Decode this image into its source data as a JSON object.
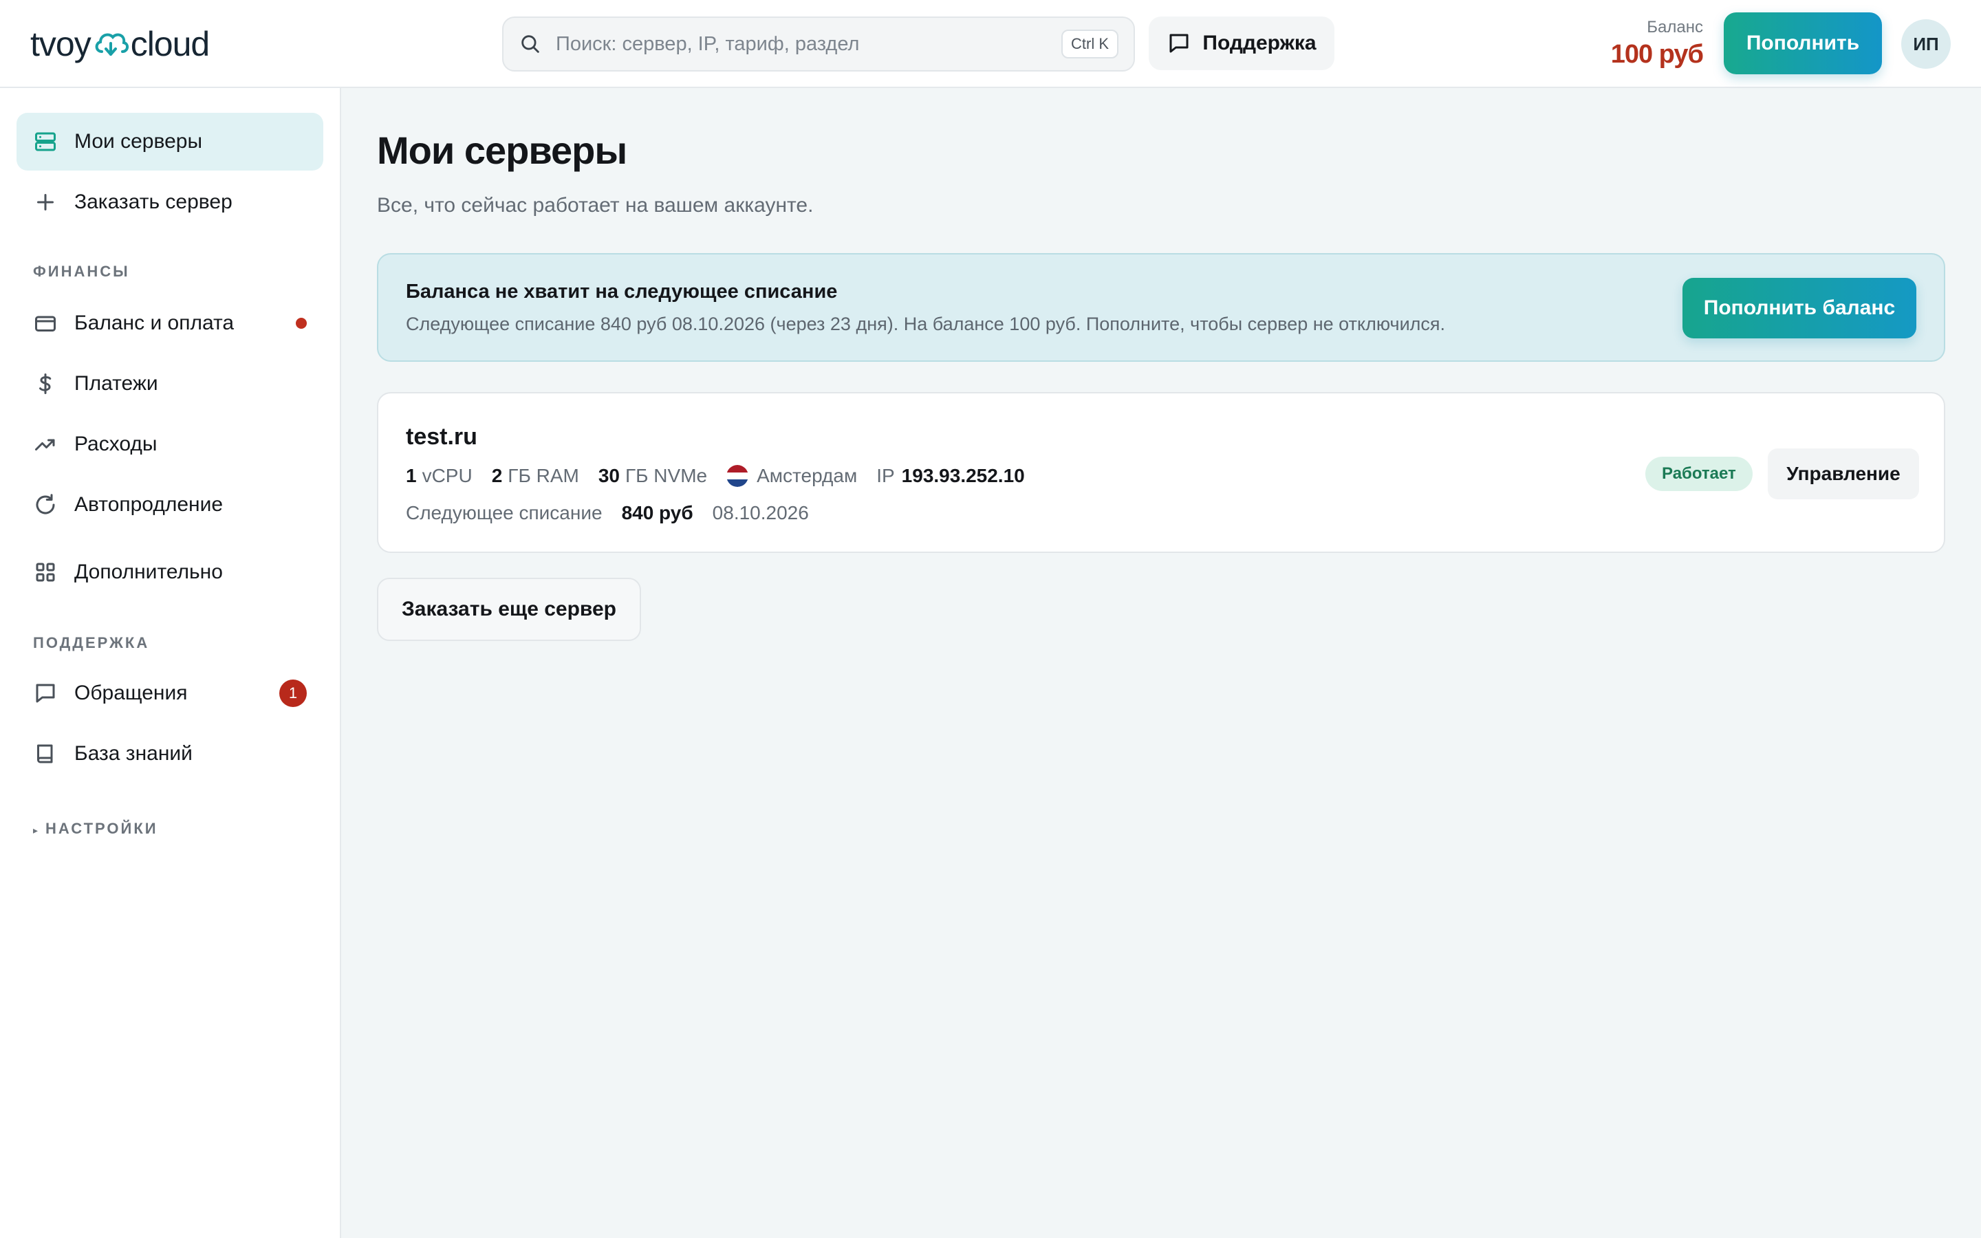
{
  "brand": {
    "logo_left": "tvoy",
    "logo_right": "cloud",
    "accent": "#18a98f",
    "accent2": "#1496c8",
    "danger": "#b4321d"
  },
  "header": {
    "search_placeholder": "Поиск: сервер, IP, тариф, раздел",
    "search_shortcut": "Ctrl K",
    "support_label": "Поддержка",
    "balance_label": "Баланс",
    "balance_value": "100 руб",
    "topup_label": "Пополнить",
    "avatar_initials": "ИП"
  },
  "sidebar": {
    "my_servers": "Мои серверы",
    "order_server": "Заказать сервер",
    "finance_label": "ФИНАНСЫ",
    "balance_payment": "Баланс и оплата",
    "payments": "Платежи",
    "expenses": "Расходы",
    "autorenew": "Автопродление",
    "extra": "Дополнительно",
    "support_label": "ПОДДЕРЖКА",
    "tickets": "Обращения",
    "tickets_count": "1",
    "knowledge": "База знаний",
    "settings_label": "НАСТРОЙКИ"
  },
  "main": {
    "title": "Мои серверы",
    "subtitle": "Все, что сейчас работает на вашем аккаунте.",
    "alert": {
      "title": "Баланса не хватит на следующее списание",
      "text": "Следующее списание 840 руб 08.10.2026 (через 23 дня). На балансе 100 руб. Пополните, чтобы сервер не отключился.",
      "button": "Пополнить баланс"
    },
    "server": {
      "name": "test.ru",
      "cpu_value": "1",
      "cpu_unit": "vCPU",
      "ram_value": "2",
      "ram_unit": "ГБ RAM",
      "disk_value": "30",
      "disk_unit": "ГБ NVMe",
      "location": "Амстердам",
      "ip_label": "IP",
      "ip": "193.93.252.10",
      "next_charge_label": "Следующее списание",
      "next_charge_amount": "840 руб",
      "next_charge_date": "08.10.2026",
      "status": "Работает",
      "manage": "Управление"
    },
    "order_more": "Заказать еще сервер"
  }
}
